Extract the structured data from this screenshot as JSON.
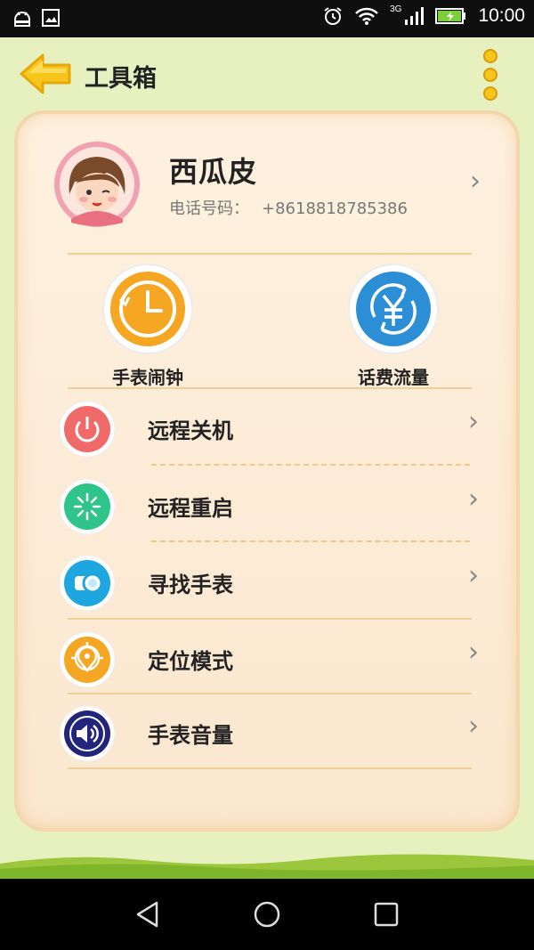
{
  "status_bar": {
    "time": "10:00",
    "network": "3G",
    "icons": [
      "android-debug-icon",
      "screenshot-icon",
      "alarm-icon",
      "wifi-icon",
      "signal-icon",
      "battery-charging-icon"
    ]
  },
  "header": {
    "title": "工具箱",
    "back_icon": "arrow-left-icon",
    "menu_icon": "more-vertical-icon"
  },
  "profile": {
    "name": "西瓜皮",
    "phone_label": "电话号码：",
    "phone_number": "+8618818785386"
  },
  "quick_actions": [
    {
      "label": "手表闹钟",
      "icon": "alarm-clock-icon",
      "color": "#f5a623"
    },
    {
      "label": "话费流量",
      "icon": "yuan-refresh-icon",
      "color": "#2c8fd6"
    }
  ],
  "menu_items": [
    {
      "label": "远程关机",
      "icon": "power-icon",
      "color": "#f06a6a"
    },
    {
      "label": "远程重启",
      "icon": "restart-icon",
      "color": "#2ec48a"
    },
    {
      "label": "寻找手表",
      "icon": "watch-icon",
      "color": "#1ea6e0"
    },
    {
      "label": "定位模式",
      "icon": "location-target-icon",
      "color": "#f5a623"
    },
    {
      "label": "手表音量",
      "icon": "volume-icon",
      "color": "#22257a"
    }
  ],
  "colors": {
    "background": "#e7f1c0",
    "card": "#fdf1df",
    "accent": "#f5c518"
  }
}
